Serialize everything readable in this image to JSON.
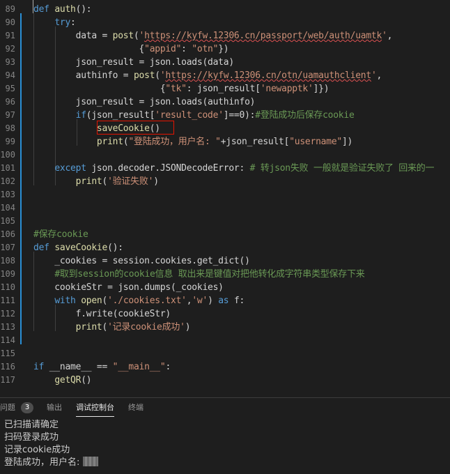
{
  "editor": {
    "lines": [
      {
        "n": "89",
        "tokens": [
          [
            "kw",
            "def "
          ],
          [
            "fn",
            "auth"
          ],
          [
            "",
            "():"
          ]
        ]
      },
      {
        "n": "90",
        "tokens": [
          [
            "",
            "    "
          ],
          [
            "kw",
            "try"
          ],
          [
            "",
            ":"
          ]
        ]
      },
      {
        "n": "91",
        "tokens": [
          [
            "",
            "        data = "
          ],
          [
            "fn",
            "post"
          ],
          [
            "",
            "("
          ],
          [
            "st",
            "'"
          ],
          [
            "st ul",
            "https://kyfw.12306.cn/passport/web/auth/uamtk"
          ],
          [
            "st",
            "'"
          ],
          [
            "",
            ","
          ]
        ]
      },
      {
        "n": "92",
        "tokens": [
          [
            "",
            "                    {"
          ],
          [
            "st",
            "\"appid\""
          ],
          [
            "",
            ": "
          ],
          [
            "st",
            "\"otn\""
          ],
          [
            "",
            "})"
          ]
        ]
      },
      {
        "n": "93",
        "tokens": [
          [
            "",
            "        json_result = json.loads(data)"
          ]
        ]
      },
      {
        "n": "94",
        "tokens": [
          [
            "",
            "        authinfo = "
          ],
          [
            "fn",
            "post"
          ],
          [
            "",
            "("
          ],
          [
            "st",
            "'"
          ],
          [
            "st ul",
            "https://kyfw.12306.cn/otn/uamauthclient"
          ],
          [
            "st",
            "'"
          ],
          [
            "",
            ","
          ]
        ]
      },
      {
        "n": "95",
        "tokens": [
          [
            "",
            "                        {"
          ],
          [
            "st",
            "\"tk\""
          ],
          [
            "",
            ": json_result["
          ],
          [
            "st",
            "'newapptk'"
          ],
          [
            "",
            "]})"
          ]
        ]
      },
      {
        "n": "96",
        "tokens": [
          [
            "",
            "        json_result = json.loads(authinfo)"
          ]
        ]
      },
      {
        "n": "97",
        "tokens": [
          [
            "",
            "        "
          ],
          [
            "kw",
            "if"
          ],
          [
            "",
            "(json_result["
          ],
          [
            "st",
            "'result_code'"
          ],
          [
            "",
            "]==0):"
          ],
          [
            "cm",
            "#登陆成功后保存cookie"
          ]
        ]
      },
      {
        "n": "98",
        "tokens": [
          [
            "",
            "            "
          ],
          [
            "fn",
            "saveCookie"
          ],
          [
            "",
            "()"
          ]
        ]
      },
      {
        "n": "99",
        "tokens": [
          [
            "",
            "            "
          ],
          [
            "fn",
            "print"
          ],
          [
            "",
            "("
          ],
          [
            "st",
            "\"登陆成功，用户名: \""
          ],
          [
            "",
            "+json_result["
          ],
          [
            "st",
            "\"username\""
          ],
          [
            "",
            "])"
          ]
        ]
      },
      {
        "n": "100",
        "tokens": [
          [
            "",
            ""
          ]
        ]
      },
      {
        "n": "101",
        "tokens": [
          [
            "",
            "    "
          ],
          [
            "kw",
            "except"
          ],
          [
            "",
            " json.decoder.JSONDecodeError: "
          ],
          [
            "cm",
            "# 转json失败 一般就是验证失败了 回来的一"
          ]
        ]
      },
      {
        "n": "102",
        "tokens": [
          [
            "",
            "        "
          ],
          [
            "fn",
            "print"
          ],
          [
            "",
            "("
          ],
          [
            "st",
            "'验证失败'"
          ],
          [
            "",
            ")"
          ]
        ]
      },
      {
        "n": "103",
        "tokens": [
          [
            "",
            ""
          ]
        ]
      },
      {
        "n": "104",
        "tokens": [
          [
            "",
            ""
          ]
        ]
      },
      {
        "n": "105",
        "tokens": [
          [
            "",
            ""
          ]
        ]
      },
      {
        "n": "106",
        "tokens": [
          [
            "cm",
            "#保存cookie"
          ]
        ]
      },
      {
        "n": "107",
        "tokens": [
          [
            "kw",
            "def "
          ],
          [
            "fn",
            "saveCookie"
          ],
          [
            "",
            "():"
          ]
        ]
      },
      {
        "n": "108",
        "tokens": [
          [
            "",
            "    _cookies = session.cookies.get_dict()"
          ]
        ]
      },
      {
        "n": "109",
        "tokens": [
          [
            "",
            "    "
          ],
          [
            "cm",
            "#取到session的cookie信息 取出来是键值对把他转化成字符串类型保存下来"
          ]
        ]
      },
      {
        "n": "110",
        "tokens": [
          [
            "",
            "    cookieStr = json.dumps(_cookies)"
          ]
        ]
      },
      {
        "n": "111",
        "tokens": [
          [
            "",
            "    "
          ],
          [
            "kw",
            "with "
          ],
          [
            "fn",
            "open"
          ],
          [
            "",
            "("
          ],
          [
            "st",
            "'./cookies.txt'"
          ],
          [
            "",
            ","
          ],
          [
            "st",
            "'w'"
          ],
          [
            "",
            ") "
          ],
          [
            "kw",
            "as"
          ],
          [
            "",
            " f:"
          ]
        ]
      },
      {
        "n": "112",
        "tokens": [
          [
            "",
            "        f.write(cookieStr)"
          ]
        ]
      },
      {
        "n": "113",
        "tokens": [
          [
            "",
            "        "
          ],
          [
            "fn",
            "print"
          ],
          [
            "",
            "("
          ],
          [
            "st",
            "'记录cookie成功'"
          ],
          [
            "",
            ")"
          ]
        ]
      },
      {
        "n": "114",
        "tokens": [
          [
            "",
            ""
          ]
        ]
      },
      {
        "n": "115",
        "tokens": [
          [
            "",
            ""
          ]
        ]
      },
      {
        "n": "116",
        "tokens": [
          [
            "kw",
            "if"
          ],
          [
            "",
            " __name__ == "
          ],
          [
            "st",
            "\"__main__\""
          ],
          [
            "",
            ":"
          ]
        ]
      },
      {
        "n": "117",
        "tokens": [
          [
            "",
            "    "
          ],
          [
            "fn",
            "getQR"
          ],
          [
            "",
            "()"
          ]
        ]
      }
    ]
  },
  "panel": {
    "tabs": [
      {
        "label": "问题",
        "badge": "3",
        "active": false
      },
      {
        "label": "输出",
        "active": false
      },
      {
        "label": "调试控制台",
        "active": true
      },
      {
        "label": "终端",
        "active": false
      }
    ],
    "console_lines": [
      "已扫描请确定",
      "扫码登录成功",
      "记录cookie成功",
      "登陆成功，用户名: "
    ]
  },
  "colors": {
    "keyword": "#569cd6",
    "function": "#dcdcaa",
    "string": "#ce9178",
    "comment": "#6a9955",
    "highlight_box": "#e51400"
  }
}
